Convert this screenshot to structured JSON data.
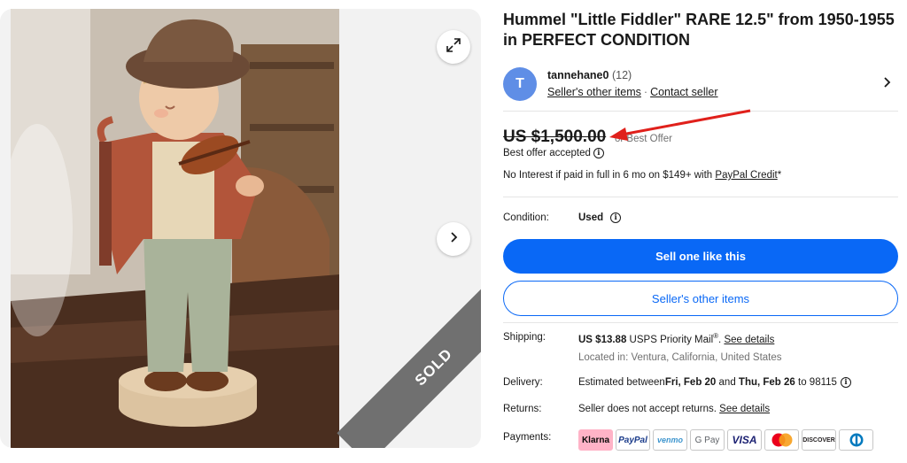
{
  "listing": {
    "title": "Hummel \"Little Fiddler\" RARE 12.5\" from 1950-1955 in PERFECT CONDITION",
    "sold_label": "SOLD"
  },
  "seller": {
    "initial": "T",
    "name": "tannehane0",
    "feedback": "(12)",
    "other_items_link": "Seller's other items",
    "separator": "·",
    "contact_link": "Contact seller"
  },
  "price": {
    "amount": "US $1,500.00",
    "offer_note": "or Best Offer",
    "accepted": "Best offer accepted",
    "financing_prefix": "No Interest if paid in full in 6 mo on $149+ with ",
    "financing_link": "PayPal Credit",
    "financing_suffix": "*"
  },
  "condition": {
    "label": "Condition:",
    "value": "Used"
  },
  "actions": {
    "primary": "Sell one like this",
    "secondary": "Seller's other items"
  },
  "shipping": {
    "label": "Shipping:",
    "cost": "US $13.88",
    "service": " USPS Priority Mail",
    "registered": "®",
    "separator": ". ",
    "details_link": "See details",
    "location": "Located in: Ventura, California, United States"
  },
  "delivery": {
    "label": "Delivery:",
    "prefix": "Estimated between ",
    "start": "Fri, Feb 20",
    "and": " and ",
    "end": "Thu, Feb 26",
    "suffix": " to 98115"
  },
  "returns": {
    "label": "Returns:",
    "text": "Seller does not accept returns. ",
    "details_link": "See details"
  },
  "payments": {
    "label": "Payments:",
    "methods": [
      "Klarna",
      "PayPal",
      "venmo",
      "G Pay",
      "VISA",
      "Mastercard",
      "DISCOVER",
      "Diners Club"
    ]
  },
  "icons": {
    "expand": "expand-icon",
    "next": "chevron-right-icon",
    "seller_chevron": "chevron-right-icon",
    "info": "info-icon",
    "annotation": "red-arrow-annotation"
  },
  "colors": {
    "primary": "#0968f6",
    "annotation": "#e0201b",
    "avatar": "#5f8ee6"
  }
}
